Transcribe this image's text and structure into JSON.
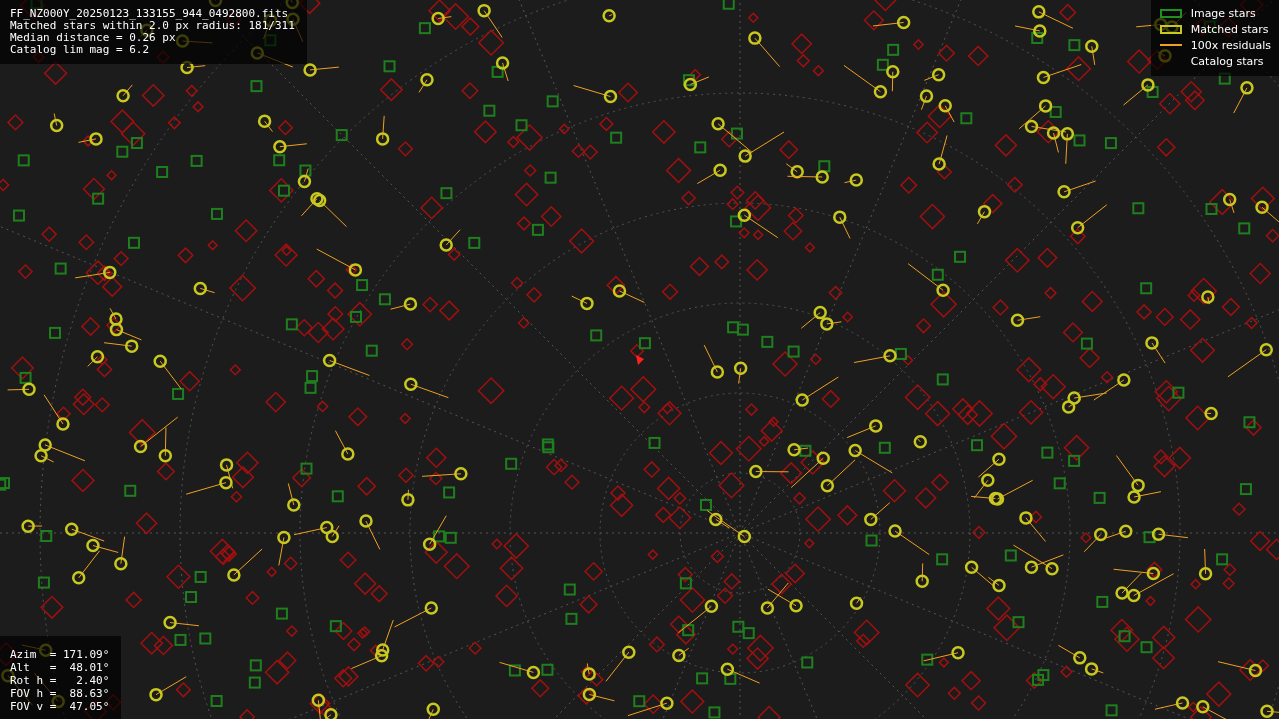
{
  "info_top": [
    "FF_NZ000Y_20250123_133155_944_0492800.fits",
    "Matched stars within 2.0 px radius: 181/311",
    "Median distance = 0.26 px",
    "Catalog lim mag = 6.2"
  ],
  "legend": [
    {
      "kind": "box",
      "color": "#1f8f1f",
      "label": "Image stars"
    },
    {
      "kind": "box",
      "color": "#c8c81e",
      "label": "Matched stars"
    },
    {
      "kind": "line",
      "color": "#f0a020",
      "label": "100x residuals"
    },
    {
      "kind": "none",
      "label": "Catalog stars"
    }
  ],
  "info_bottom": [
    "Azim  = 171.09°",
    "Alt   =  48.01°",
    "Rot h =   2.40°",
    "FOV h =  88.63°",
    "FOV v =  47.05°"
  ]
}
